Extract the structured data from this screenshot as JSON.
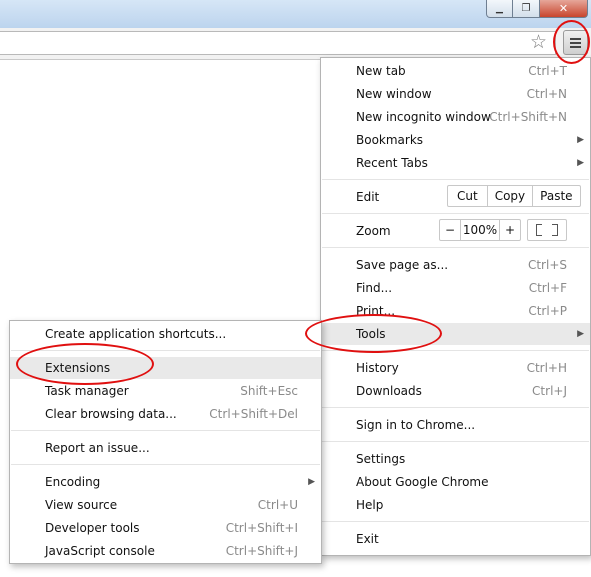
{
  "window": {
    "minimize_glyph": "▁",
    "maximize_glyph": "❐",
    "close_glyph": "✕",
    "bookmark_star_glyph": "☆"
  },
  "main_menu": {
    "new_tab": {
      "label": "New tab",
      "shortcut": "Ctrl+T"
    },
    "new_window": {
      "label": "New window",
      "shortcut": "Ctrl+N"
    },
    "new_incognito": {
      "label": "New incognito window",
      "shortcut": "Ctrl+Shift+N"
    },
    "bookmarks": {
      "label": "Bookmarks"
    },
    "recent_tabs": {
      "label": "Recent Tabs"
    },
    "edit": {
      "label": "Edit",
      "cut": "Cut",
      "copy": "Copy",
      "paste": "Paste"
    },
    "zoom": {
      "label": "Zoom",
      "minus": "−",
      "level": "100%",
      "plus": "+"
    },
    "save_page": {
      "label": "Save page as...",
      "shortcut": "Ctrl+S"
    },
    "find": {
      "label": "Find...",
      "shortcut": "Ctrl+F"
    },
    "print": {
      "label": "Print...",
      "shortcut": "Ctrl+P"
    },
    "tools": {
      "label": "Tools"
    },
    "history": {
      "label": "History",
      "shortcut": "Ctrl+H"
    },
    "downloads": {
      "label": "Downloads",
      "shortcut": "Ctrl+J"
    },
    "sign_in": {
      "label": "Sign in to Chrome..."
    },
    "settings": {
      "label": "Settings"
    },
    "about": {
      "label": "About Google Chrome"
    },
    "help": {
      "label": "Help"
    },
    "exit": {
      "label": "Exit"
    }
  },
  "tools_menu": {
    "create_shortcuts": {
      "label": "Create application shortcuts..."
    },
    "extensions": {
      "label": "Extensions"
    },
    "task_manager": {
      "label": "Task manager",
      "shortcut": "Shift+Esc"
    },
    "clear_browsing": {
      "label": "Clear browsing data...",
      "shortcut": "Ctrl+Shift+Del"
    },
    "report_issue": {
      "label": "Report an issue..."
    },
    "encoding": {
      "label": "Encoding"
    },
    "view_source": {
      "label": "View source",
      "shortcut": "Ctrl+U"
    },
    "developer_tools": {
      "label": "Developer tools",
      "shortcut": "Ctrl+Shift+I"
    },
    "js_console": {
      "label": "JavaScript console",
      "shortcut": "Ctrl+Shift+J"
    }
  },
  "colors": {
    "annotation": "#e01010",
    "highlight": "#e9e9e9"
  }
}
